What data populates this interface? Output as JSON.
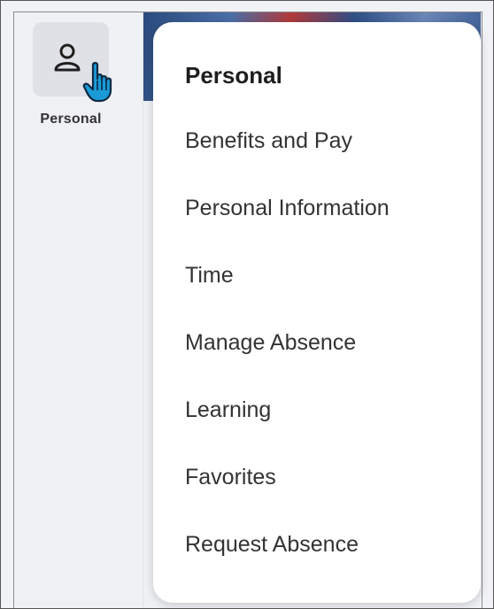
{
  "nav": {
    "personal_tile_label": "Personal"
  },
  "menu": {
    "title": "Personal",
    "items": [
      {
        "label": "Benefits and Pay"
      },
      {
        "label": "Personal Information"
      },
      {
        "label": "Time"
      },
      {
        "label": "Manage Absence"
      },
      {
        "label": "Learning"
      },
      {
        "label": "Favorites"
      },
      {
        "label": "Request Absence"
      }
    ]
  },
  "icons": {
    "tile_icon": "person-icon",
    "cursor": "hand-pointer-cursor"
  },
  "colors": {
    "cursor_fill": "#1a9bd7",
    "panel_background": "#ffffff",
    "tile_background": "#dfe1e6"
  }
}
